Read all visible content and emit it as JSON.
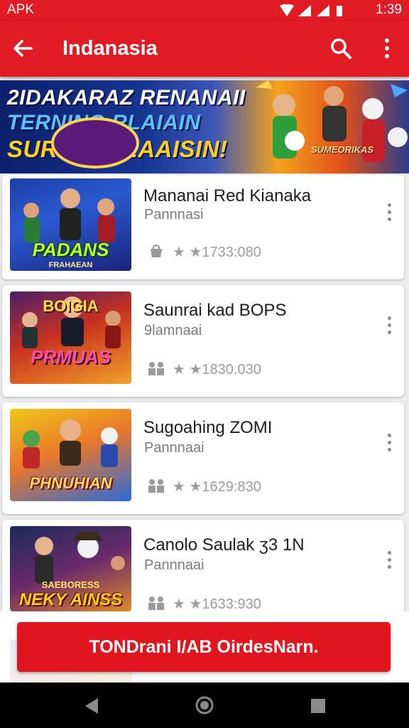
{
  "status_bar": {
    "left_label": "APK",
    "time": "1:39"
  },
  "app_bar": {
    "title": "Indanasia",
    "back_icon": "arrow-left-icon",
    "search_icon": "search-icon",
    "overflow_icon": "more-vert-icon"
  },
  "banner": {
    "lines": [
      "2IDAKARAZ RENANAII",
      "TERNING RLAIAIN",
      "SURNCI PEAAISIN!"
    ],
    "badge": "SUMEORIKAS"
  },
  "games": [
    {
      "title": "Mananai Red Kianaka",
      "subtitle": "Pannnasi",
      "rating_text": "★ ★1733:080",
      "thumb_label": "PADANS",
      "thumb_sub": "FRAHAEAN"
    },
    {
      "title": "Saunrai kad BOPS",
      "subtitle": "9lamnaai",
      "rating_text": "★ ★1830.030",
      "thumb_label": "PRMUAS",
      "thumb_sub": "BOIGIA"
    },
    {
      "title": "Sugoahing ZOMI",
      "subtitle": "Pannnaai",
      "rating_text": "★ ★1629:830",
      "thumb_label": "PHNUHIAN",
      "thumb_sub": ""
    },
    {
      "title": "Canolo Saulak ʒ3 1N",
      "subtitle": "Pannnaai",
      "rating_text": "★ ★1633:930",
      "thumb_label": "NEKY AINSS",
      "thumb_sub": "SAEBORESS"
    }
  ],
  "cta": {
    "label": "TONDrani I/AB OirdesNarn."
  },
  "colors": {
    "primary": "#e01b23",
    "background": "#ececec",
    "card": "#ffffff",
    "text": "#1d1d1d",
    "muted": "#7a7a7a"
  }
}
